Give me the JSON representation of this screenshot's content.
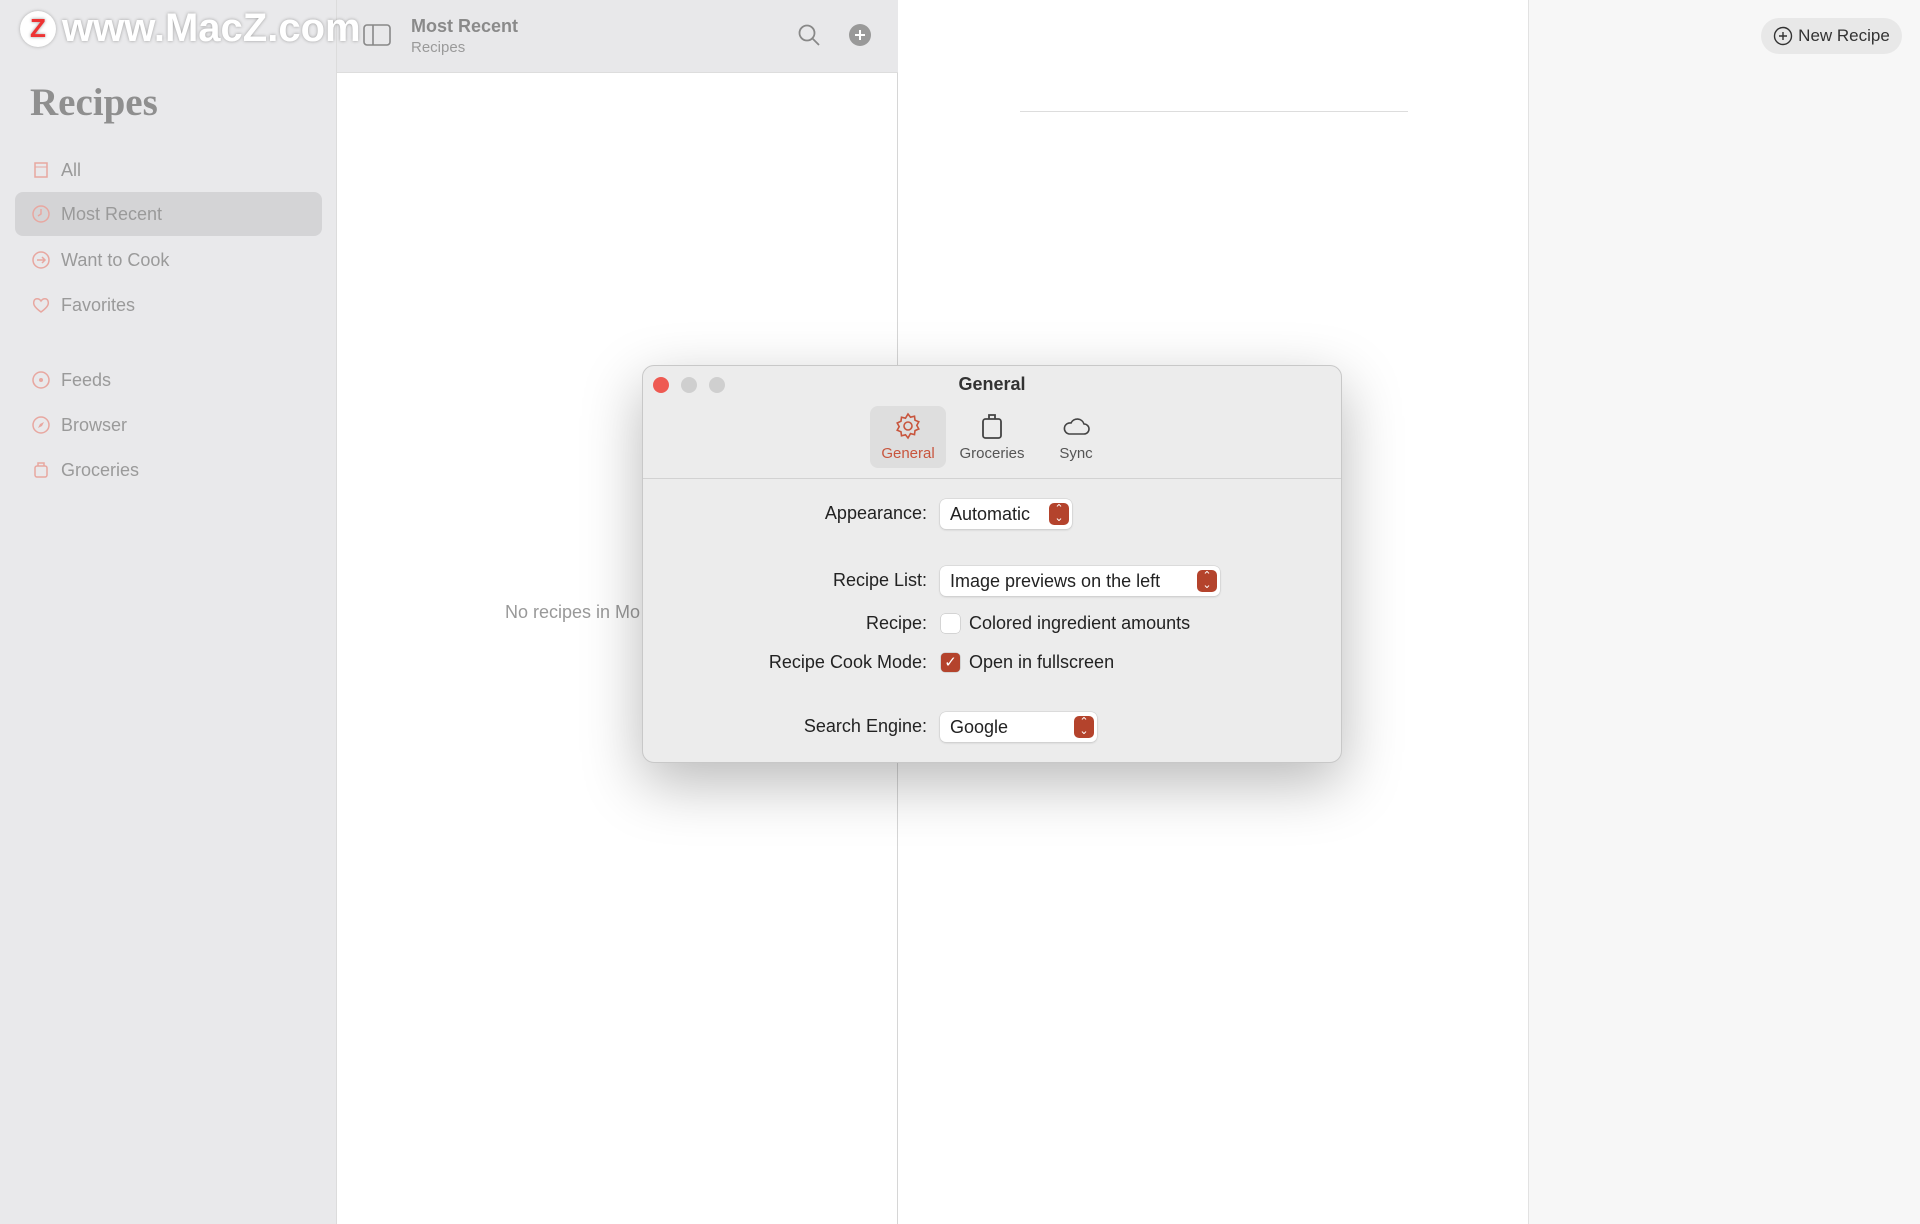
{
  "watermark": "www.MacZ.com",
  "sidebar": {
    "title": "Recipes",
    "items": [
      {
        "label": "All",
        "icon": "archive-icon"
      },
      {
        "label": "Most Recent",
        "icon": "clock-icon",
        "selected": true
      },
      {
        "label": "Want to Cook",
        "icon": "arrow-circle-icon"
      },
      {
        "label": "Favorites",
        "icon": "heart-icon"
      },
      {
        "label": "Feeds",
        "icon": "feed-icon"
      },
      {
        "label": "Browser",
        "icon": "compass-icon"
      },
      {
        "label": "Groceries",
        "icon": "bag-icon"
      }
    ]
  },
  "list": {
    "title": "Most Recent",
    "subtitle": "Recipes",
    "empty_text": "No recipes in Mo"
  },
  "toolbar": {
    "new_recipe": "New Recipe"
  },
  "colors": {
    "accent": "#b4432c",
    "close": "#ee5a52"
  },
  "dialog": {
    "title": "General",
    "tabs": [
      {
        "label": "General",
        "icon": "gear-icon",
        "selected": true
      },
      {
        "label": "Groceries",
        "icon": "bag-icon"
      },
      {
        "label": "Sync",
        "icon": "cloud-icon"
      }
    ],
    "appearance": {
      "label": "Appearance:",
      "value": "Automatic"
    },
    "recipe_list": {
      "label": "Recipe List:",
      "value": "Image previews on the left"
    },
    "recipe": {
      "label": "Recipe:",
      "option": "Colored ingredient amounts",
      "checked": false
    },
    "cook_mode": {
      "label": "Recipe Cook Mode:",
      "option": "Open in fullscreen",
      "checked": true
    },
    "search_engine": {
      "label": "Search Engine:",
      "value": "Google"
    }
  }
}
